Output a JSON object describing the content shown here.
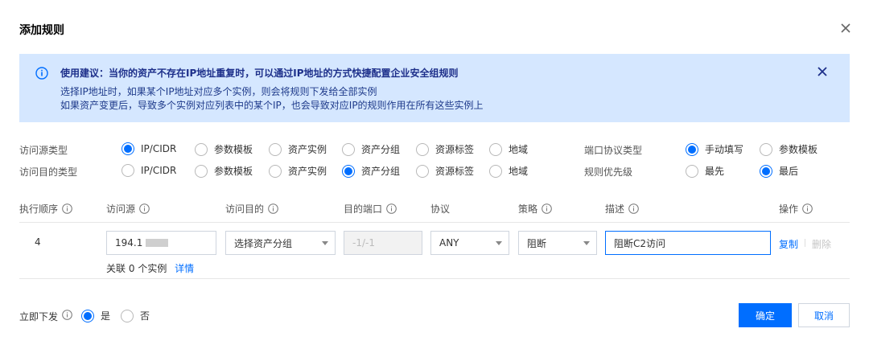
{
  "dialog": {
    "title": "添加规则"
  },
  "notice": {
    "heading": "使用建议：当你的资产不存在IP地址重复时，可以通过IP地址的方式快捷配置企业安全组规则",
    "line1": "选择IP地址时，如果某个IP地址对应多个实例，则会将规则下发给全部实例",
    "line2": "如果资产变更后，导致多个实例对应列表中的某个IP，也会导致对应IP的规则作用在所有这些实例上"
  },
  "source_type": {
    "label": "访问源类型",
    "options": [
      "IP/CIDR",
      "参数模板",
      "资产实例",
      "资产分组",
      "资源标签",
      "地域"
    ],
    "selected": "IP/CIDR"
  },
  "dest_type": {
    "label": "访问目的类型",
    "options": [
      "IP/CIDR",
      "参数模板",
      "资产实例",
      "资产分组",
      "资源标签",
      "地域"
    ],
    "selected": "资产分组"
  },
  "port_type": {
    "label": "端口协议类型",
    "options": [
      "手动填写",
      "参数模板"
    ],
    "selected": "手动填写"
  },
  "priority": {
    "label": "规则优先级",
    "options": [
      "最先",
      "最后"
    ],
    "selected": "最后"
  },
  "table": {
    "headers": [
      "执行顺序",
      "访问源",
      "访问目的",
      "目的端口",
      "协议",
      "策略",
      "描述",
      "操作"
    ],
    "row": {
      "order": "4",
      "source": "194.1",
      "dest": "选择资产分组",
      "port": "-1/-1",
      "protocol": "ANY",
      "policy": "阻断",
      "description": "阻断C2访问",
      "copy": "复制",
      "delete": "删除"
    },
    "assoc_prefix": "关联",
    "assoc_count": "0",
    "assoc_suffix": "个实例",
    "details": "详情"
  },
  "deploy": {
    "label": "立即下发",
    "yes": "是",
    "no": "否",
    "selected": "是"
  },
  "buttons": {
    "confirm": "确定",
    "cancel": "取消"
  },
  "colors": {
    "accent": "#006eff",
    "notice_bg": "#d5e7ff"
  }
}
